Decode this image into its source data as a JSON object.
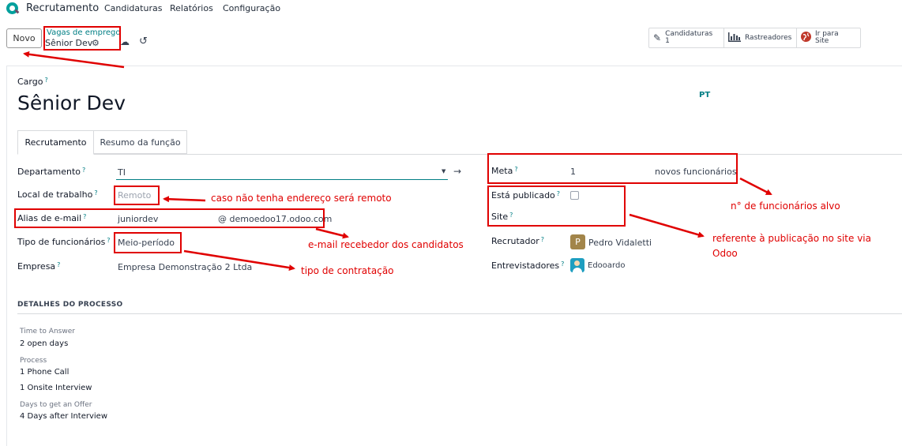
{
  "app": {
    "title": "Recrutamento",
    "menu": [
      "Candidaturas",
      "Relatórios",
      "Configuração"
    ]
  },
  "control_panel": {
    "new_button": "Novo",
    "breadcrumb_parent": "Vagas de emprego",
    "breadcrumb_current": "Sênior Dev",
    "smart_buttons": [
      {
        "icon": "pencil-icon",
        "label": "Candidaturas",
        "count": "1"
      },
      {
        "icon": "bar-chart-icon",
        "label": "Rastreadores",
        "count": ""
      },
      {
        "icon": "globe-icon",
        "label": "Ir para",
        "sub": "Site"
      }
    ]
  },
  "form": {
    "job_label": "Cargo",
    "job_title": "Sênior Dev",
    "lang_badge": "PT",
    "tabs": [
      "Recrutamento",
      "Resumo da função"
    ],
    "left": {
      "department": {
        "label": "Departamento",
        "value": "TI"
      },
      "location": {
        "label": "Local de trabalho",
        "placeholder": "Remoto"
      },
      "email_alias": {
        "label": "Alias de e-mail",
        "value": "juniordev",
        "domain": "@ demoedoo17.odoo.com"
      },
      "employment_type": {
        "label": "Tipo de funcionários",
        "value": "Meio-período"
      },
      "company": {
        "label": "Empresa",
        "value": "Empresa Demonstração 2 Ltda"
      }
    },
    "right": {
      "target": {
        "label": "Meta",
        "value": "1",
        "suffix": "novos funcionários"
      },
      "published": {
        "label": "Está publicado",
        "checked": false
      },
      "website": {
        "label": "Site"
      },
      "recruiter": {
        "label": "Recrutador",
        "avatar": "P",
        "value": "Pedro Vidaletti"
      },
      "interviewers": {
        "label": "Entrevistadores",
        "value": "Edooardo"
      }
    },
    "process": {
      "title": "DETALHES DO PROCESSO",
      "time_to_answer_label": "Time to Answer",
      "time_to_answer": "2 open days",
      "process_label": "Process",
      "process_steps": [
        "1 Phone Call",
        "1 Onsite Interview"
      ],
      "offer_label": "Days to get an Offer",
      "offer_value": "4 Days after Interview"
    }
  },
  "annotations": {
    "remote": "caso não tenha endereço será remoto",
    "email": "e-mail recebedor dos candidatos",
    "contract": "tipo de contratação",
    "target": "n° de funcionários alvo",
    "publication_line1": "referente à publicação no site via",
    "publication_line2": "Odoo"
  },
  "colors": {
    "annotation": "#e00000",
    "link": "#017e84",
    "avatar_recruiter": "#a2854a"
  }
}
